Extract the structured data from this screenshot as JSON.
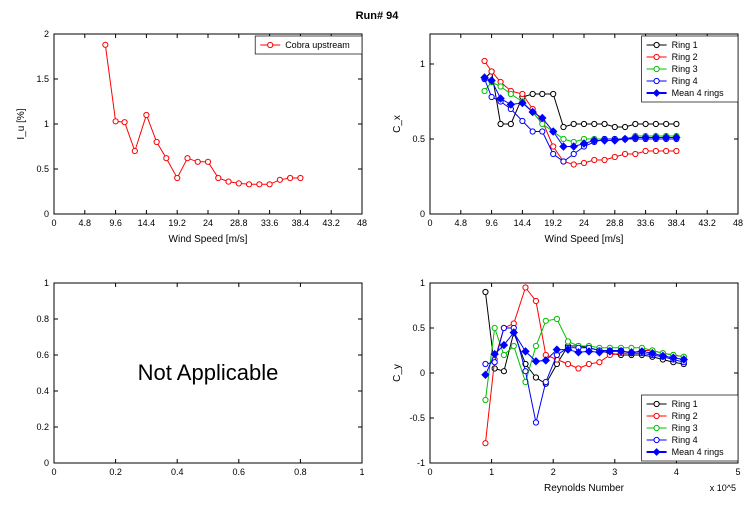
{
  "title": "Run# 94",
  "panels": {
    "tl": {
      "legend_items": [
        {
          "name": "Cobra upstream",
          "color": "#ff0000"
        }
      ],
      "xlabel": "Wind Speed [m/s]",
      "ylabel": "I_u [%]"
    },
    "tr": {
      "legend_items": [
        {
          "name": "Ring 1",
          "color": "#000000"
        },
        {
          "name": "Ring 2",
          "color": "#ff0000"
        },
        {
          "name": "Ring 3",
          "color": "#00c000"
        },
        {
          "name": "Ring 4",
          "color": "#0000ff"
        },
        {
          "name": "Mean 4 rings",
          "color": "#0000ff",
          "diamond": true
        }
      ],
      "xlabel": "Wind Speed [m/s]",
      "ylabel": "C_x"
    },
    "bl": {
      "text": "Not Applicable"
    },
    "br": {
      "legend_items": [
        {
          "name": "Ring 1",
          "color": "#000000"
        },
        {
          "name": "Ring 2",
          "color": "#ff0000"
        },
        {
          "name": "Ring 3",
          "color": "#00c000"
        },
        {
          "name": "Ring 4",
          "color": "#0000ff"
        },
        {
          "name": "Mean 4 rings",
          "color": "#0000ff",
          "diamond": true
        }
      ],
      "xlabel": "Reynolds Number",
      "ylabel": "C_y",
      "xexp": "x 10^5"
    }
  },
  "chart_data": [
    {
      "id": "tl",
      "type": "line",
      "title": "",
      "xlabel": "Wind Speed [m/s]",
      "ylabel": "I_u [%]",
      "xlim": [
        0,
        48
      ],
      "ylim": [
        0,
        2
      ],
      "xticks": [
        0,
        4.8,
        9.6,
        14.4,
        19.2,
        24,
        28.8,
        33.6,
        38.4,
        43.2,
        48
      ],
      "yticks": [
        0,
        0.5,
        1,
        1.5,
        2
      ],
      "series": [
        {
          "name": "Cobra upstream",
          "color": "#ff0000",
          "marker": "o",
          "x": [
            8.0,
            9.6,
            11.0,
            12.6,
            14.4,
            16.0,
            17.5,
            19.2,
            20.8,
            22.4,
            24.0,
            25.6,
            27.2,
            28.8,
            30.4,
            32.0,
            33.6,
            35.2,
            36.8,
            38.4
          ],
          "y": [
            1.88,
            1.03,
            1.02,
            0.7,
            1.1,
            0.8,
            0.62,
            0.4,
            0.62,
            0.58,
            0.58,
            0.4,
            0.36,
            0.34,
            0.33,
            0.33,
            0.33,
            0.38,
            0.4,
            0.4
          ]
        }
      ]
    },
    {
      "id": "tr",
      "type": "line",
      "title": "",
      "xlabel": "Wind Speed [m/s]",
      "ylabel": "C_x",
      "xlim": [
        0,
        48
      ],
      "ylim": [
        0,
        1.2
      ],
      "xticks": [
        0,
        4.8,
        9.6,
        14.4,
        19.2,
        24,
        28.8,
        33.6,
        38.4,
        43.2,
        48
      ],
      "yticks": [
        0,
        0.5,
        1
      ],
      "series": [
        {
          "name": "Ring 1",
          "color": "#000000",
          "marker": "o",
          "x": [
            8.5,
            9.6,
            11.0,
            12.6,
            14.4,
            16.0,
            17.5,
            19.2,
            20.8,
            22.4,
            24.0,
            25.6,
            27.2,
            28.8,
            30.4,
            32.0,
            33.6,
            35.2,
            36.8,
            38.4
          ],
          "y": [
            0.9,
            0.95,
            0.6,
            0.6,
            0.78,
            0.8,
            0.8,
            0.8,
            0.58,
            0.6,
            0.6,
            0.6,
            0.6,
            0.58,
            0.58,
            0.6,
            0.6,
            0.6,
            0.6,
            0.6
          ]
        },
        {
          "name": "Ring 2",
          "color": "#ff0000",
          "marker": "o",
          "x": [
            8.5,
            9.6,
            11.0,
            12.6,
            14.4,
            16.0,
            17.5,
            19.2,
            20.8,
            22.4,
            24.0,
            25.6,
            27.2,
            28.8,
            30.4,
            32.0,
            33.6,
            35.2,
            36.8,
            38.4
          ],
          "y": [
            1.02,
            0.95,
            0.88,
            0.82,
            0.8,
            0.7,
            0.62,
            0.45,
            0.35,
            0.33,
            0.34,
            0.36,
            0.36,
            0.38,
            0.4,
            0.4,
            0.42,
            0.42,
            0.42,
            0.42
          ]
        },
        {
          "name": "Ring 3",
          "color": "#00c000",
          "marker": "o",
          "x": [
            8.5,
            9.6,
            11.0,
            12.6,
            14.4,
            16.0,
            17.5,
            19.2,
            20.8,
            22.4,
            24.0,
            25.6,
            27.2,
            28.8,
            30.4,
            32.0,
            33.6,
            35.2,
            36.8,
            38.4
          ],
          "y": [
            0.82,
            0.88,
            0.85,
            0.8,
            0.75,
            0.68,
            0.6,
            0.55,
            0.5,
            0.48,
            0.5,
            0.5,
            0.5,
            0.5,
            0.5,
            0.52,
            0.52,
            0.52,
            0.52,
            0.52
          ]
        },
        {
          "name": "Ring 4",
          "color": "#0000ff",
          "marker": "o",
          "x": [
            8.5,
            9.6,
            11.0,
            12.6,
            14.4,
            16.0,
            17.5,
            19.2,
            20.8,
            22.4,
            24.0,
            25.6,
            27.2,
            28.8,
            30.4,
            32.0,
            33.6,
            35.2,
            36.8,
            38.4
          ],
          "y": [
            0.9,
            0.78,
            0.75,
            0.7,
            0.62,
            0.55,
            0.55,
            0.4,
            0.35,
            0.4,
            0.45,
            0.48,
            0.5,
            0.5,
            0.5,
            0.5,
            0.5,
            0.5,
            0.5,
            0.5
          ]
        },
        {
          "name": "Mean 4 rings",
          "color": "#0000ff",
          "marker": "d",
          "thick": true,
          "x": [
            8.5,
            9.6,
            11.0,
            12.6,
            14.4,
            16.0,
            17.5,
            19.2,
            20.8,
            22.4,
            24.0,
            25.6,
            27.2,
            28.8,
            30.4,
            32.0,
            33.6,
            35.2,
            36.8,
            38.4
          ],
          "y": [
            0.91,
            0.89,
            0.77,
            0.73,
            0.74,
            0.68,
            0.64,
            0.55,
            0.45,
            0.45,
            0.47,
            0.49,
            0.49,
            0.49,
            0.5,
            0.51,
            0.51,
            0.51,
            0.51,
            0.51
          ]
        }
      ]
    },
    {
      "id": "bl",
      "type": "blank",
      "xlim": [
        0,
        1
      ],
      "ylim": [
        0,
        1
      ],
      "xticks": [
        0,
        0.2,
        0.4,
        0.6,
        0.8,
        1
      ],
      "yticks": [
        0,
        0.2,
        0.4,
        0.6,
        0.8,
        1
      ],
      "text": "Not Applicable"
    },
    {
      "id": "br",
      "type": "line",
      "title": "",
      "xlabel": "Reynolds Number",
      "ylabel": "C_y",
      "xlim": [
        0,
        5
      ],
      "ylim": [
        -1,
        1
      ],
      "xticks": [
        0,
        1,
        2,
        3,
        4,
        5
      ],
      "yticks": [
        -1,
        -0.5,
        0,
        0.5,
        1
      ],
      "x_multiplier_label": "x 10^5",
      "series": [
        {
          "name": "Ring 1",
          "color": "#000000",
          "marker": "o",
          "x": [
            0.9,
            1.05,
            1.2,
            1.36,
            1.55,
            1.72,
            1.88,
            2.06,
            2.24,
            2.41,
            2.58,
            2.75,
            2.92,
            3.1,
            3.27,
            3.44,
            3.61,
            3.78,
            3.95,
            4.12
          ],
          "y": [
            0.9,
            0.05,
            0.02,
            0.45,
            0.1,
            -0.05,
            -0.12,
            0.1,
            0.3,
            0.3,
            0.28,
            0.25,
            0.22,
            0.2,
            0.2,
            0.2,
            0.18,
            0.15,
            0.12,
            0.1
          ]
        },
        {
          "name": "Ring 2",
          "color": "#ff0000",
          "marker": "o",
          "x": [
            0.9,
            1.05,
            1.2,
            1.36,
            1.55,
            1.72,
            1.88,
            2.06,
            2.24,
            2.41,
            2.58,
            2.75,
            2.92,
            3.1,
            3.27,
            3.44,
            3.61,
            3.78,
            3.95,
            4.12
          ],
          "y": [
            -0.78,
            0.15,
            0.5,
            0.55,
            0.95,
            0.8,
            0.2,
            0.15,
            0.1,
            0.05,
            0.1,
            0.12,
            0.2,
            0.22,
            0.22,
            0.25,
            0.25,
            0.22,
            0.2,
            0.18
          ]
        },
        {
          "name": "Ring 3",
          "color": "#00c000",
          "marker": "o",
          "x": [
            0.9,
            1.05,
            1.2,
            1.36,
            1.55,
            1.72,
            1.88,
            2.06,
            2.24,
            2.41,
            2.58,
            2.75,
            2.92,
            3.1,
            3.27,
            3.44,
            3.61,
            3.78,
            3.95,
            4.12
          ],
          "y": [
            -0.3,
            0.5,
            0.2,
            0.3,
            -0.1,
            0.3,
            0.58,
            0.6,
            0.35,
            0.3,
            0.3,
            0.28,
            0.28,
            0.28,
            0.28,
            0.28,
            0.25,
            0.22,
            0.2,
            0.18
          ]
        },
        {
          "name": "Ring 4",
          "color": "#0000ff",
          "marker": "o",
          "x": [
            0.9,
            1.05,
            1.2,
            1.36,
            1.55,
            1.72,
            1.88,
            2.06,
            2.24,
            2.41,
            2.58,
            2.75,
            2.92,
            3.1,
            3.27,
            3.44,
            3.61,
            3.78,
            3.95,
            4.12
          ],
          "y": [
            0.1,
            0.12,
            0.5,
            0.5,
            0.02,
            -0.55,
            -0.1,
            0.2,
            0.28,
            0.28,
            0.28,
            0.25,
            0.25,
            0.25,
            0.22,
            0.22,
            0.2,
            0.18,
            0.15,
            0.12
          ]
        },
        {
          "name": "Mean 4 rings",
          "color": "#0000ff",
          "marker": "d",
          "thick": true,
          "x": [
            0.9,
            1.05,
            1.2,
            1.36,
            1.55,
            1.72,
            1.88,
            2.06,
            2.24,
            2.41,
            2.58,
            2.75,
            2.92,
            3.1,
            3.27,
            3.44,
            3.61,
            3.78,
            3.95,
            4.12
          ],
          "y": [
            -0.02,
            0.21,
            0.31,
            0.45,
            0.24,
            0.13,
            0.14,
            0.26,
            0.26,
            0.23,
            0.24,
            0.23,
            0.24,
            0.24,
            0.23,
            0.24,
            0.22,
            0.19,
            0.17,
            0.15
          ]
        }
      ]
    }
  ]
}
